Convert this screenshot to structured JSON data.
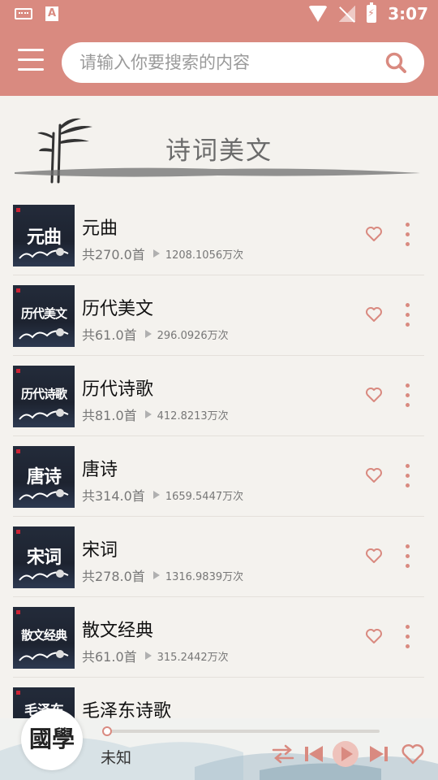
{
  "status_bar": {
    "time": "3:07",
    "left_icons": [
      "keyboard-icon",
      "app-a-icon"
    ],
    "right_icons": [
      "wifi-icon",
      "no-signal-icon",
      "battery-charging-icon"
    ]
  },
  "search": {
    "placeholder": "请输入你要搜索的内容"
  },
  "banner": {
    "title": "诗词美文"
  },
  "list": {
    "items": [
      {
        "name": "元曲",
        "count": "共270.0首",
        "plays": "1208.1056万次",
        "cover": "元曲"
      },
      {
        "name": "历代美文",
        "count": "共61.0首",
        "plays": "296.0926万次",
        "cover": "历代美文"
      },
      {
        "name": "历代诗歌",
        "count": "共81.0首",
        "plays": "412.8213万次",
        "cover": "历代诗歌"
      },
      {
        "name": "唐诗",
        "count": "共314.0首",
        "plays": "1659.5447万次",
        "cover": "唐诗"
      },
      {
        "name": "宋词",
        "count": "共278.0首",
        "plays": "1316.9839万次",
        "cover": "宋词"
      },
      {
        "name": "散文经典",
        "count": "共61.0首",
        "plays": "315.2442万次",
        "cover": "散文经典"
      },
      {
        "name": "毛泽东诗歌",
        "count": "",
        "plays": "",
        "cover": "毛泽东"
      }
    ]
  },
  "player": {
    "track_title": "未知",
    "avatar_logo": "國學",
    "progress": 0.0
  },
  "colors": {
    "accent": "#d98a80",
    "background": "#f4f2ee"
  }
}
